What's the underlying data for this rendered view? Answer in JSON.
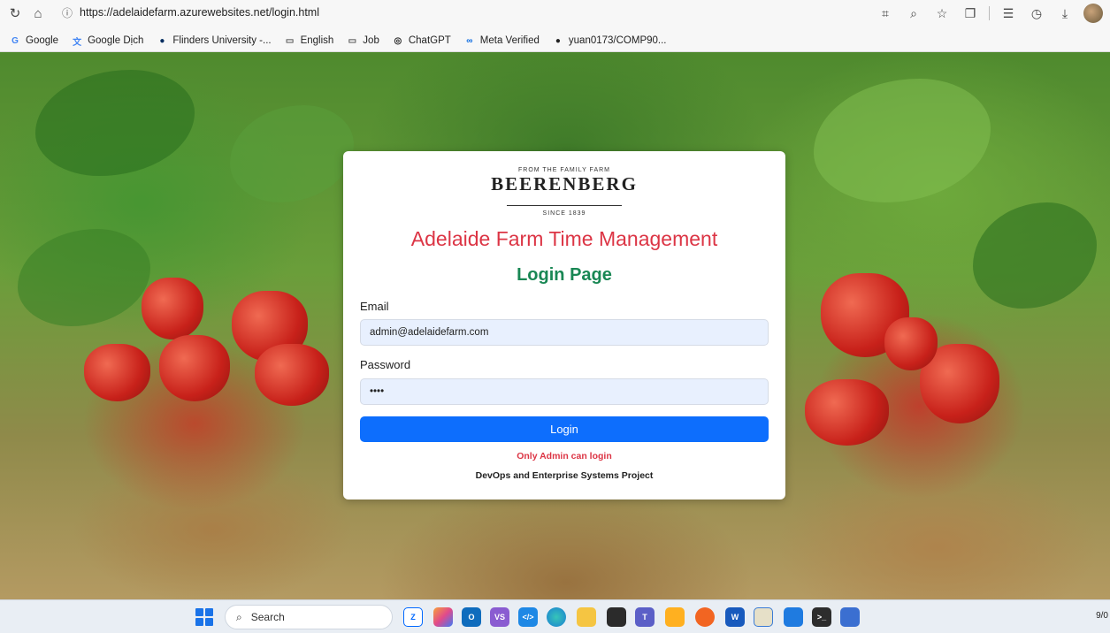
{
  "browser": {
    "url": "https://adelaidefarm.azurewebsites.net/login.html",
    "bookmarks": [
      {
        "label": "Google",
        "icon": "google-icon",
        "color": "#4285f4"
      },
      {
        "label": "Google Dịch",
        "icon": "translate-icon",
        "color": "#4285f4"
      },
      {
        "label": "Flinders University -...",
        "icon": "flinders-icon",
        "color": "#002c5f"
      },
      {
        "label": "English",
        "icon": "folder-icon",
        "color": "#555555"
      },
      {
        "label": "Job",
        "icon": "folder-icon",
        "color": "#555555"
      },
      {
        "label": "ChatGPT",
        "icon": "chatgpt-icon",
        "color": "#222222"
      },
      {
        "label": "Meta Verified",
        "icon": "meta-icon",
        "color": "#0668e1"
      },
      {
        "label": "yuan0173/COMP90...",
        "icon": "github-icon",
        "color": "#222222"
      }
    ]
  },
  "login": {
    "logo": {
      "tagline_top": "FROM THE FAMILY FARM",
      "brand": "BEERENBERG",
      "tagline_bottom": "SINCE 1839"
    },
    "title": "Adelaide Farm Time Management",
    "subtitle": "Login Page",
    "email_label": "Email",
    "email_value": "admin@adelaidefarm.com",
    "password_label": "Password",
    "password_value": "••••",
    "login_button": "Login",
    "admin_note": "Only Admin can login",
    "footer_note": "DevOps and Enterprise Systems Project",
    "colors": {
      "title": "#dc3545",
      "subtitle": "#198754",
      "button": "#0d6efd"
    }
  },
  "taskbar": {
    "search_placeholder": "Search",
    "clock": "9/0"
  }
}
